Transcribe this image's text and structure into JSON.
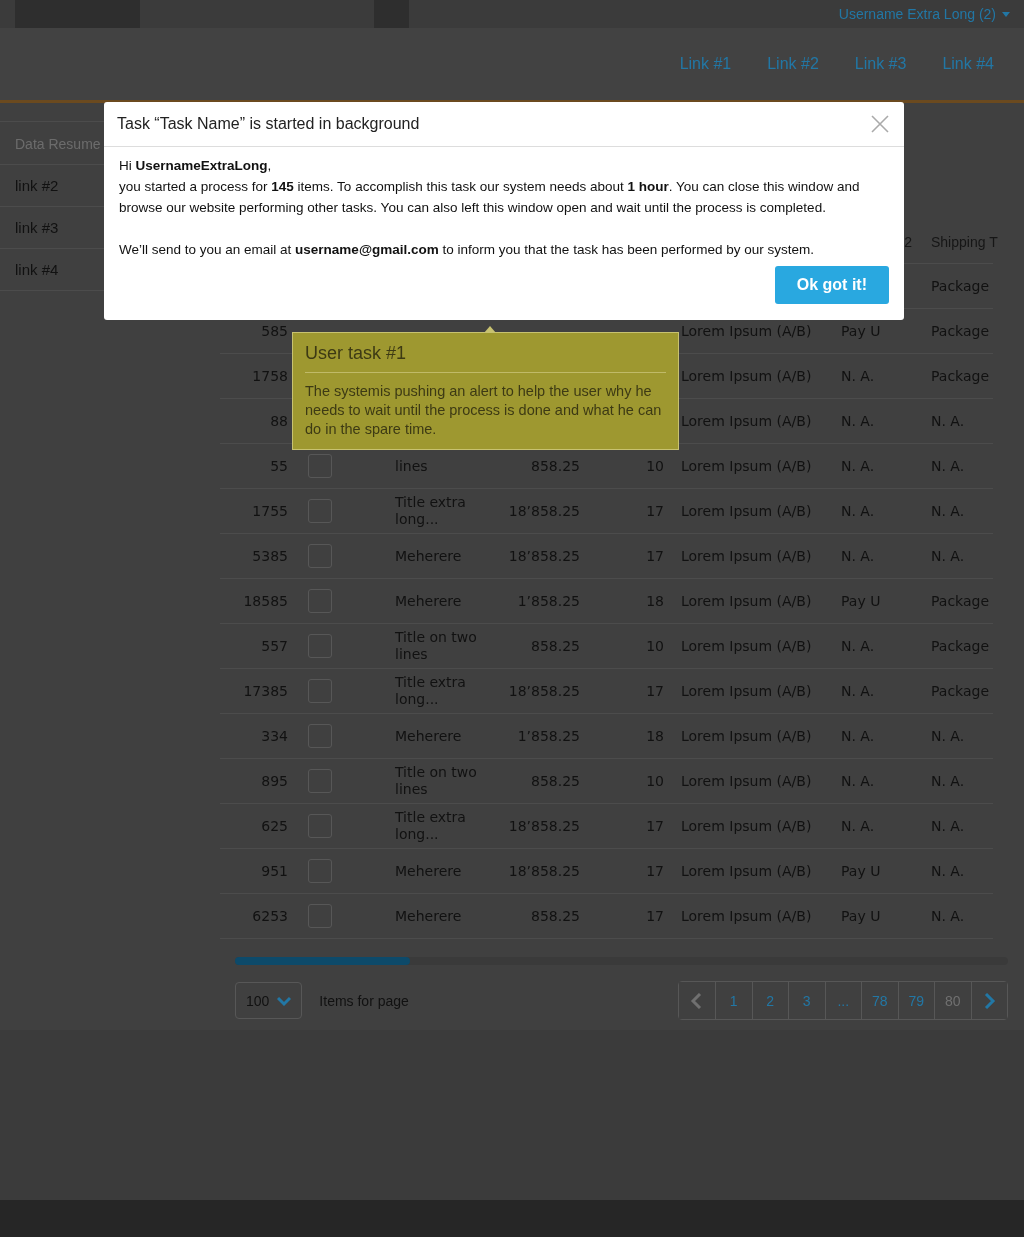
{
  "top_bar": {
    "user_menu": "Username Extra Long (2)"
  },
  "nav": {
    "links": [
      "Link #1",
      "Link #2",
      "Link #3",
      "Link #4"
    ]
  },
  "sidebar": {
    "title": "Data Resume",
    "items": [
      "link #2",
      "link #3",
      "link #4"
    ]
  },
  "table": {
    "header": {
      "column_7": "2",
      "column_8": "Shipping T"
    },
    "rows": [
      {
        "shipping": "Package"
      },
      {
        "id": "585",
        "description": "Lorem Ipsum (A/B)",
        "payment": "Pay U",
        "shipping": "Package"
      },
      {
        "id": "1758",
        "description": "Lorem Ipsum (A/B)",
        "payment": "N. A.",
        "shipping": "Package"
      },
      {
        "id": "88",
        "description": "Lorem Ipsum (A/B)",
        "payment": "N. A.",
        "shipping": "N. A."
      },
      {
        "id": "55",
        "checked": false,
        "title": "lines",
        "price": "858.25",
        "qty": "10",
        "description": "Lorem Ipsum (A/B)",
        "payment": "N. A.",
        "shipping": "N. A."
      },
      {
        "id": "1755",
        "checked": false,
        "title": "Title extra long...",
        "price": "18’858.25",
        "qty": "17",
        "description": "Lorem Ipsum (A/B)",
        "payment": "N. A.",
        "shipping": "N. A."
      },
      {
        "id": "5385",
        "checked": false,
        "title": "Meherere",
        "price": "18’858.25",
        "qty": "17",
        "description": "Lorem Ipsum (A/B)",
        "payment": "N. A.",
        "shipping": "N. A."
      },
      {
        "id": "18585",
        "checked": false,
        "title": "Meherere",
        "price": "1’858.25",
        "qty": "18",
        "description": "Lorem Ipsum (A/B)",
        "payment": "Pay U",
        "shipping": "Package"
      },
      {
        "id": "557",
        "checked": false,
        "title": "Title on two lines",
        "price": "858.25",
        "qty": "10",
        "description": "Lorem Ipsum (A/B)",
        "payment": "N. A.",
        "shipping": "Package"
      },
      {
        "id": "17385",
        "checked": false,
        "title": "Title extra long...",
        "price": "18’858.25",
        "qty": "17",
        "description": "Lorem Ipsum (A/B)",
        "payment": "N. A.",
        "shipping": "Package"
      },
      {
        "id": "334",
        "checked": false,
        "title": "Meherere",
        "price": "1’858.25",
        "qty": "18",
        "description": "Lorem Ipsum (A/B)",
        "payment": "N. A.",
        "shipping": "N. A."
      },
      {
        "id": "895",
        "checked": false,
        "title": "Title on two lines",
        "price": "858.25",
        "qty": "10",
        "description": "Lorem Ipsum (A/B)",
        "payment": "N. A.",
        "shipping": "N. A."
      },
      {
        "id": "625",
        "checked": false,
        "title": "Title extra long...",
        "price": "18’858.25",
        "qty": "17",
        "description": "Lorem Ipsum (A/B)",
        "payment": "N. A.",
        "shipping": "N. A."
      },
      {
        "id": "951",
        "checked": false,
        "title": "Meherere",
        "price": "18’858.25",
        "qty": "17",
        "description": "Lorem Ipsum (A/B)",
        "payment": "Pay U",
        "shipping": "N. A."
      },
      {
        "id": "6253",
        "checked": false,
        "title": "Meherere",
        "price": "858.25",
        "qty": "17",
        "description": "Lorem Ipsum (A/B)",
        "payment": "Pay U",
        "shipping": "N. A."
      }
    ]
  },
  "per_page": {
    "value": "100",
    "label": "Items for page"
  },
  "pagination": [
    {
      "kind": "prev",
      "disabled": true
    },
    {
      "kind": "page",
      "label": "1",
      "disabled": false
    },
    {
      "kind": "page",
      "label": "2",
      "disabled": false
    },
    {
      "kind": "page",
      "label": "3",
      "disabled": false
    },
    {
      "kind": "page",
      "label": "...",
      "disabled": false
    },
    {
      "kind": "page",
      "label": "78",
      "disabled": false
    },
    {
      "kind": "page",
      "label": "79",
      "disabled": false
    },
    {
      "kind": "page",
      "label": "80",
      "disabled": true
    },
    {
      "kind": "next",
      "disabled": false
    }
  ],
  "modal": {
    "title": "Task “Task Name” is started in background",
    "greeting": "Hi **UsernameExtraLong**,",
    "body": "you started a process for **145** items. To accomplish this task our system needs about **1 hour**. You can close this window and browse our website performing other tasks. You can also left this window open and wait until the process is completed.",
    "notice": "We’ll send to you an email at **username@gmail.com** to inform you that the task has been performed by our system.",
    "button": "Ok got it!"
  },
  "tooltip": {
    "title": "User task #1",
    "body": "The systemis pushing an alert to help the user why he needs to wait until the process is done and what he can do in the spare time."
  }
}
